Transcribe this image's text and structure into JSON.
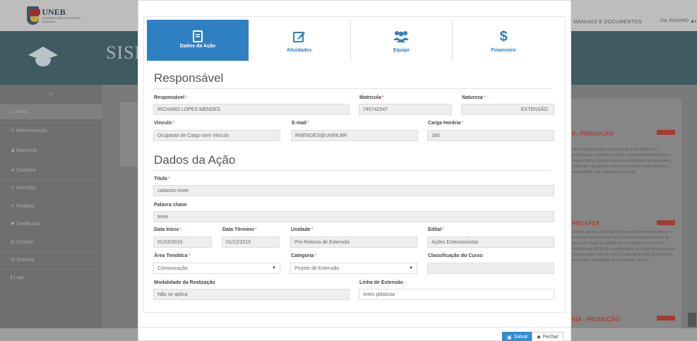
{
  "background": {
    "brand": "UNEB",
    "brand_sub": "UNIVERSIDADE DO ESTADO DA BAHIA",
    "top_menu": "MANUAIS E DOCUMENTOS",
    "user": "Olá, RICHARD",
    "banner_text": "SISE",
    "sidebar_search": "⊞",
    "sidebar": [
      {
        "label": "Início",
        "icon": "home-icon"
      },
      {
        "label": "Administração",
        "icon": "wrench-icon"
      },
      {
        "label": "Monitoria",
        "icon": "users-icon"
      },
      {
        "label": "Cadastro",
        "icon": "list-icon"
      },
      {
        "label": "Inscrição",
        "icon": "edit-icon"
      },
      {
        "label": "Projetos",
        "icon": "edit-icon"
      },
      {
        "label": "Certificado",
        "icon": "certificate-icon"
      },
      {
        "label": "Contato",
        "icon": "envelope-icon"
      },
      {
        "label": "Sistema",
        "icon": "gears-icon"
      },
      {
        "label": "Logs",
        "icon": "info-icon"
      }
    ],
    "right_panel": {
      "item1_title": "9 - PRODUÇÃO",
      "item1_text": "ção e disseminação da produção a científica e/ou tecnológica, esportiva, ovação e empreendedorismo bem como rtístico, que promovem a articulação das de ensino, extensão e pesquisa e favoreça imento, como também o intercâmbio ocal, regional e nacional.",
      "item2_title": "PROAPEX",
      "item2_text": "ama de Apoio a Projetos de Extensão que visa reafirmar a Extensão Universitária no e institucionalizado através do apoio às ntexto da UNEB. Em consonância com o nto Institucional (PDI) são considerados os compromisso social destas ações visando onal e o fortalecimento da extensão, desta ção. Submissão de propostas: 26/03 a",
      "item3_title": "018 - PRODUÇÃO",
      "badge": "Atenção"
    }
  },
  "wizard": {
    "steps": [
      {
        "label": "Dados da Ação",
        "icon": "book-icon",
        "active": true
      },
      {
        "label": "Atividades",
        "icon": "pencil-square-icon",
        "active": false
      },
      {
        "label": "Equipe",
        "icon": "users-icon",
        "active": false
      },
      {
        "label": "Financeiro",
        "icon": "dollar-icon",
        "active": false
      }
    ]
  },
  "responsavel_section": {
    "title": "Responsável",
    "responsavel": {
      "label": "Responsável",
      "value": "RICHARD LOPES MENDES"
    },
    "matricula": {
      "label": "Matricula",
      "value": "745742547"
    },
    "natureza": {
      "label": "Natureza",
      "value": "EXTENSÃO"
    },
    "vinculo": {
      "label": "Vinculo",
      "value": "Ocupante de Cargo sem Vinculo"
    },
    "email": {
      "label": "E-mail",
      "value": "RMENDES@UNEB.BR"
    },
    "carga_horaria": {
      "label": "Carga Horária",
      "value": "180"
    }
  },
  "acao_section": {
    "title": "Dados da Ação",
    "titulo": {
      "label": "Titulo",
      "value": "cadastro teste"
    },
    "palavra_chave": {
      "label": "Palavra chave",
      "value": "teste"
    },
    "data_inicio": {
      "label": "Data Inicio",
      "value": "01/03/2019"
    },
    "data_termino": {
      "label": "Data Término",
      "value": "01/12/2019"
    },
    "unidade": {
      "label": "Unidade",
      "value": "Pró-Reitoria de Extensão"
    },
    "edital": {
      "label": "Edital",
      "value": "Ações Extensionistas"
    },
    "area_tematica": {
      "label": "Área Temática",
      "value": "Comunicação"
    },
    "categoria": {
      "label": "Categoria",
      "value": "Projeto de Extensão"
    },
    "classificacao": {
      "label": "Classificação do Curso",
      "value": ""
    },
    "modalidade": {
      "label": "Modalidade da Realização",
      "value": "Não se aplica"
    },
    "linha_extensao": {
      "label": "Linha de Extensão",
      "value": "Artes plásticas"
    }
  },
  "footer": {
    "save_label": "Salvar",
    "close_label": "Fechar"
  },
  "colors": {
    "accent": "#2f7fc3",
    "required": "#d9534f",
    "badge": "#a43b33"
  }
}
